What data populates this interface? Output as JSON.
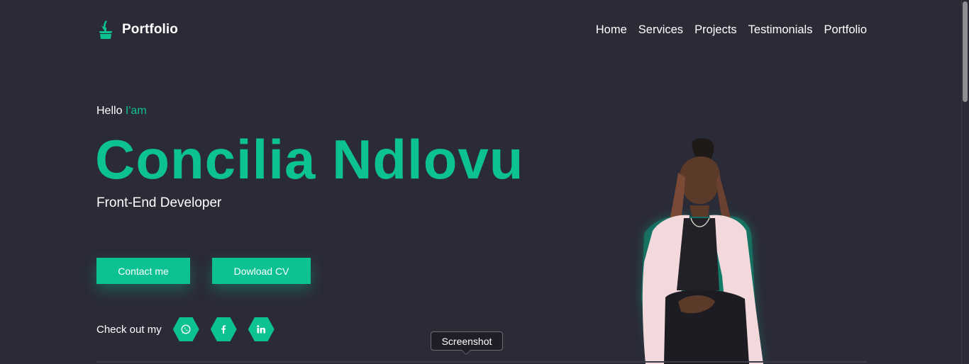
{
  "header": {
    "brand": "Portfolio",
    "logo_icon": "plant-pot-icon",
    "nav": [
      {
        "label": "Home"
      },
      {
        "label": "Services"
      },
      {
        "label": "Projects"
      },
      {
        "label": "Testimonials"
      },
      {
        "label": "Portfolio"
      }
    ]
  },
  "hero": {
    "greeting": "Hello",
    "greeting_accent": "I'am",
    "name": "Concilia Ndlovu",
    "role": "Front-End Developer",
    "contact_label": "Contact me",
    "cv_label": "Dowload CV",
    "social_label": "Check out my",
    "social_icons": [
      "whatsapp-icon",
      "facebook-icon",
      "linkedin-icon"
    ]
  },
  "tooltip": {
    "label": "Screenshot"
  },
  "colors": {
    "background": "#2b2a37",
    "accent": "#0cc192",
    "text": "#ffffff"
  }
}
